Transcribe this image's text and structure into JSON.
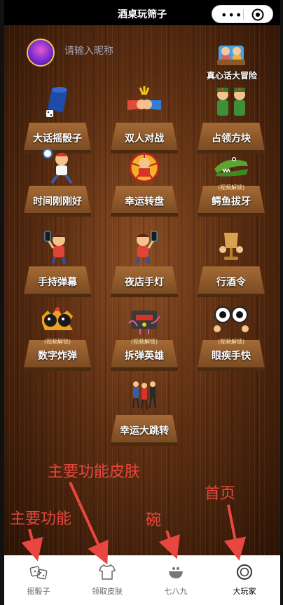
{
  "window": {
    "title": "酒桌玩筛子",
    "menu_dots": "•••"
  },
  "profile": {
    "nickname_placeholder": "请输入昵称"
  },
  "truth_or_dare": {
    "label": "真心话大冒险"
  },
  "games": [
    {
      "label": "大话摇骰子"
    },
    {
      "label": "双人对战"
    },
    {
      "label": "占领方块"
    },
    {
      "label": "时间刚刚好"
    },
    {
      "label": "幸运转盘"
    },
    {
      "label": "鳄鱼拔牙",
      "tag": "(视频解锁)"
    },
    {
      "label": "手持弹幕"
    },
    {
      "label": "夜店手灯"
    },
    {
      "label": "行酒令"
    },
    {
      "label": "数字炸弹",
      "tag": "(视频解锁)"
    },
    {
      "label": "拆弹英雄",
      "tag": "(视频解锁)"
    },
    {
      "label": "眼疾手快",
      "tag": "(视频解锁)"
    },
    {
      "label": "幸运大跳转"
    }
  ],
  "annotations": {
    "skin": "主要功能皮肤",
    "bowl": "碗",
    "home": "首页",
    "main": "主要功能"
  },
  "tabs": [
    {
      "label": "摇骰子",
      "icon": "dice-icon"
    },
    {
      "label": "领取皮肤",
      "icon": "tshirt-icon"
    },
    {
      "label": "七八九",
      "icon": "bowl-icon"
    },
    {
      "label": "大玩家",
      "icon": "ring-icon",
      "active": true
    }
  ],
  "colors": {
    "annotation": "#e8463e",
    "wood": "#5c2e12",
    "tabbar": "#ffffff"
  }
}
